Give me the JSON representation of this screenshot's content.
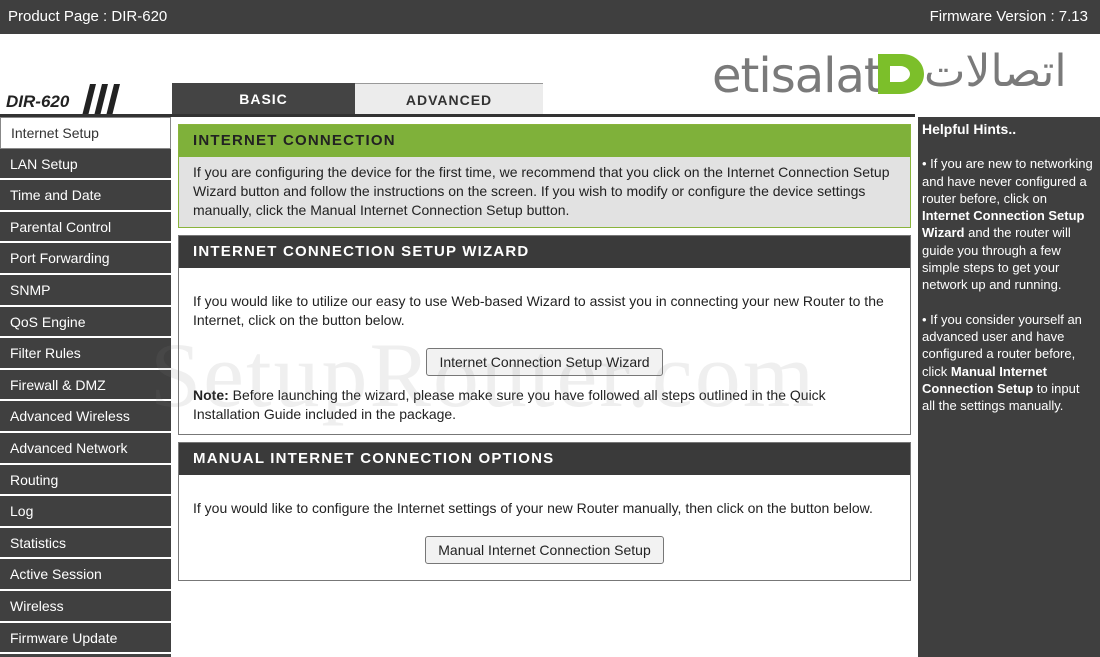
{
  "topbar": {
    "product": "Product Page :  DIR-620",
    "firmware": "Firmware Version : 7.13"
  },
  "header": {
    "model": "DIR-620",
    "tabs": [
      {
        "label": "BASIC",
        "active": false
      },
      {
        "label": "ADVANCED",
        "active": true
      }
    ],
    "logo_latin": "etisalat",
    "logo_arabic": "اتصالات"
  },
  "sidebar": {
    "items": [
      {
        "label": "Internet Setup",
        "active": true
      },
      {
        "label": "LAN Setup"
      },
      {
        "label": "Time and Date"
      },
      {
        "label": "Parental Control"
      },
      {
        "label": "Port Forwarding"
      },
      {
        "label": "SNMP"
      },
      {
        "label": "QoS Engine"
      },
      {
        "label": "Filter Rules"
      },
      {
        "label": "Firewall & DMZ"
      },
      {
        "label": "Advanced Wireless"
      },
      {
        "label": "Advanced Network"
      },
      {
        "label": "Routing"
      },
      {
        "label": "Log"
      },
      {
        "label": "Statistics"
      },
      {
        "label": "Active Session"
      },
      {
        "label": "Wireless"
      },
      {
        "label": "Firmware Update"
      }
    ]
  },
  "main": {
    "intro": {
      "title": "INTERNET CONNECTION",
      "body": "If you are configuring the device for the first time, we recommend that you click on the Internet Connection Setup Wizard button and follow the instructions on the screen. If you wish to modify or configure the device settings manually, click the Manual Internet Connection Setup button."
    },
    "wizard": {
      "title": "INTERNET CONNECTION SETUP WIZARD",
      "body": "If you would like to utilize our easy to use Web-based Wizard to assist you in connecting your new Router to the Internet, click on the button below.",
      "button": "Internet Connection Setup Wizard",
      "note_label": "Note:",
      "note": " Before launching the wizard, please make sure you have followed all steps outlined in the Quick Installation Guide included in the package."
    },
    "manual": {
      "title": "MANUAL INTERNET CONNECTION OPTIONS",
      "body": "If you would like to configure the Internet settings of your new Router manually, then click on the button below.",
      "button": "Manual Internet Connection Setup"
    }
  },
  "hints": {
    "title": "Helpful Hints..",
    "p1_a": "• If you are new to networking and have never configured a router before, click on ",
    "p1_b": "Internet Connection Setup Wizard",
    "p1_c": " and the router will guide you through a few simple steps to get your network up and running.",
    "p2_a": "• If you consider yourself an advanced user and have configured a router before, click ",
    "p2_b": "Manual Internet Connection Setup",
    "p2_c": " to input all the settings manually."
  },
  "watermark": "SetupRouter.com",
  "colors": {
    "topbar": "#3f3f3f",
    "intro_title": "#7fb13a",
    "section_title": "#3a3a3a",
    "sidebar": "#404040"
  }
}
